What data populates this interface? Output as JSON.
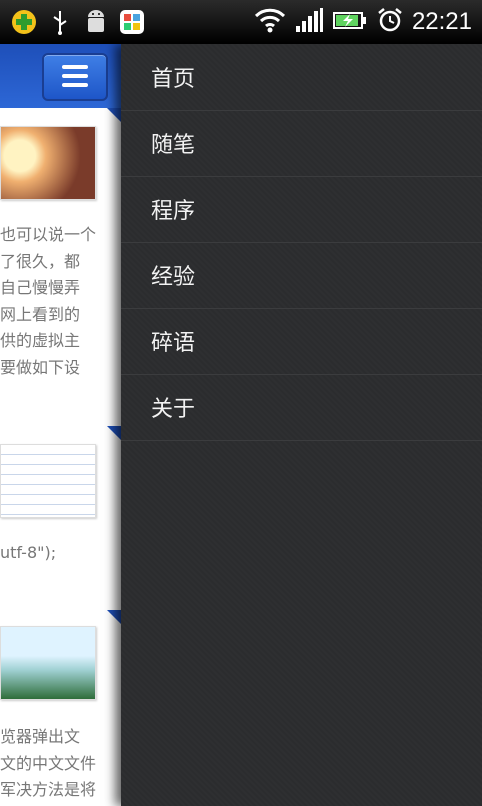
{
  "status_bar": {
    "time": "22:21",
    "left_icons": [
      "app-plus-icon",
      "usb-icon",
      "android-debug-icon",
      "app-store-icon"
    ],
    "right_icons": [
      "wifi-icon",
      "signal-icon",
      "battery-charging-icon",
      "alarm-icon"
    ]
  },
  "background_app": {
    "menu_button": "hamburger-menu-icon",
    "snippet1_lines": [
      "也可以说一个",
      "了很久，都",
      "自己慢慢弄",
      "网上看到的",
      "供的虚拟主",
      "要做如下设"
    ],
    "snippet2_lines": [
      "utf-8\");"
    ],
    "snippet3_lines": [
      "览器弹出文",
      "文的中文文件",
      "军决方法是将"
    ]
  },
  "drawer": {
    "items": [
      {
        "label": "首页"
      },
      {
        "label": "随笔"
      },
      {
        "label": "程序"
      },
      {
        "label": "经验"
      },
      {
        "label": "碎语"
      },
      {
        "label": "关于"
      }
    ]
  }
}
